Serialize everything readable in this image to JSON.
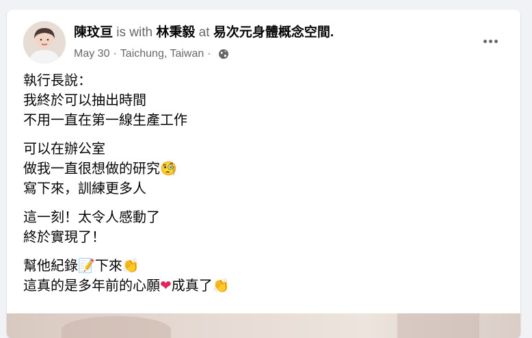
{
  "post": {
    "author": "陳玟亘",
    "with_word": "is with",
    "tagged_person": "林秉毅",
    "at_word": "at",
    "place": "易次元身體概念空間",
    "period": ".",
    "date": "May 30",
    "dot": "·",
    "location": "Taichung, Taiwan",
    "audience_icon": "globe-icon",
    "more_icon": "more-options-icon"
  },
  "content": {
    "p1": [
      "執行長說：",
      "我終於可以抽出時間",
      "不用一直在第一線生產工作"
    ],
    "p2": [
      "可以在辦公室",
      "做我一直很想做的研究",
      "寫下來，訓練更多人"
    ],
    "p2_emoji": "🧐",
    "p3": [
      "這一刻！太令人感動了",
      "終於實現了！"
    ],
    "p4_line1_a": "幫他紀錄",
    "p4_line1_emoji1": "📝",
    "p4_line1_b": "下來",
    "p4_line1_emoji2": "👏",
    "p4_line2_a": "這真的是多年前的心願",
    "p4_line2_heart": "❤",
    "p4_line2_b": "成真了",
    "p4_line2_emoji": "👏"
  },
  "colors": {
    "background": "#f0f2f5",
    "card": "#ffffff",
    "primary_text": "#050505",
    "secondary_text": "#65676b",
    "heart": "#e0245e"
  }
}
